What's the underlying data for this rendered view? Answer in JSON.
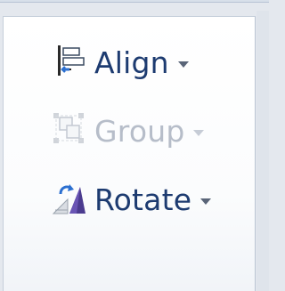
{
  "commands": [
    {
      "label": "Align",
      "icon": "align-icon",
      "enabled": true,
      "has_dropdown": true
    },
    {
      "label": "Group",
      "icon": "group-icon",
      "enabled": false,
      "has_dropdown": true
    },
    {
      "label": "Rotate",
      "icon": "rotate-icon",
      "enabled": true,
      "has_dropdown": true
    }
  ],
  "colors": {
    "label_enabled": "#1d3b70",
    "label_disabled": "#b6bdc9",
    "accent_blue": "#2b6fd0",
    "panel_border": "#c6cfdb"
  }
}
